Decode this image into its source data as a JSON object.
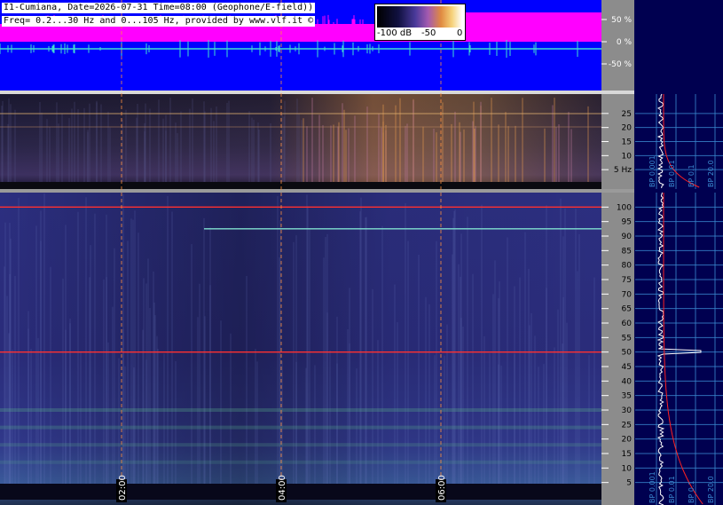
{
  "header": {
    "line1": "I1-Cumiana, Date=2026-07-31 Time=08:00 (Geophone/E-field))",
    "line2": "Freq= 0.2...30 Hz and 0...105 Hz, provided by www.vlf.it ©"
  },
  "colorbar": {
    "labels": [
      "-100 dB",
      "-50",
      "0"
    ]
  },
  "chart_data": [
    {
      "type": "area",
      "panel": "amplitude",
      "y_ticks": [
        "50 %",
        "0 %",
        "-50 %"
      ],
      "ylim": [
        -100,
        100
      ],
      "colors": {
        "background": "#0000ff",
        "upper_band": "#ff00ff",
        "trace": "#40e0d0"
      }
    },
    {
      "type": "heatmap",
      "panel": "spectrogram-low",
      "y_ticks": [
        "25",
        "20",
        "15",
        "10",
        "5 Hz"
      ],
      "y_values": [
        25,
        20,
        15,
        10,
        5
      ],
      "ylim": [
        0,
        30
      ]
    },
    {
      "type": "heatmap",
      "panel": "spectrogram-high",
      "y_ticks": [
        "100",
        "95",
        "90",
        "85",
        "80",
        "75",
        "70",
        "65",
        "60",
        "55",
        "50",
        "45",
        "40",
        "35",
        "30",
        "25",
        "20",
        "15",
        "10",
        "5"
      ],
      "y_values": [
        100,
        95,
        90,
        85,
        80,
        75,
        70,
        65,
        60,
        55,
        50,
        45,
        40,
        35,
        30,
        25,
        20,
        15,
        10,
        5
      ],
      "ylim": [
        0,
        105
      ],
      "x_ticks": [
        "02:00",
        "04:00",
        "06:00"
      ],
      "markers": [
        {
          "freq": 100,
          "color": "#ff3030"
        },
        {
          "freq": 92.5,
          "color": "#80e0d0"
        },
        {
          "freq": 50,
          "color": "#ff3030"
        }
      ]
    },
    {
      "type": "line",
      "panel": "spectrum-low",
      "x_ticks": [
        "BP 0.001",
        "BP 0.01",
        "BP 0.1",
        "BP 20.0"
      ]
    },
    {
      "type": "line",
      "panel": "spectrum-high",
      "x_ticks": [
        "BP 0.001",
        "BP 0.01",
        "BP 0.1",
        "BP 20.0"
      ],
      "peak_freq": 50
    }
  ]
}
